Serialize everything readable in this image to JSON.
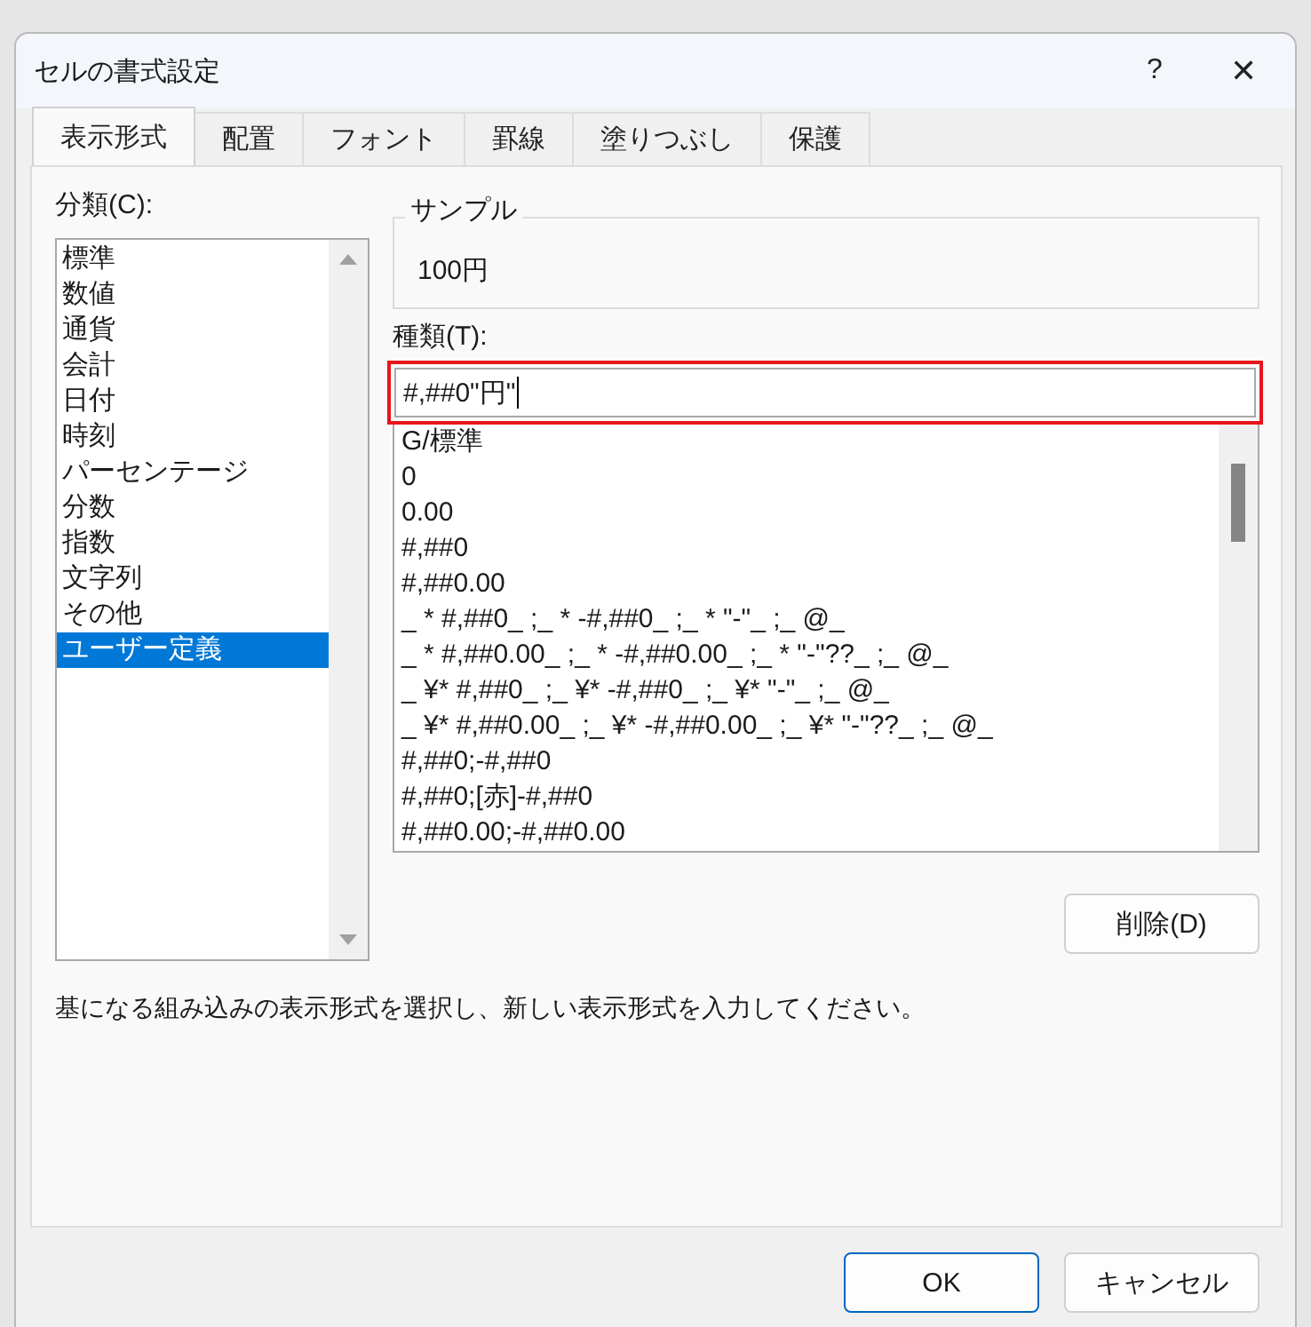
{
  "window": {
    "title": "セルの書式設定",
    "help": "?",
    "close": "✕"
  },
  "tabs": [
    {
      "label": "表示形式",
      "selected": true
    },
    {
      "label": "配置",
      "selected": false
    },
    {
      "label": "フォント",
      "selected": false
    },
    {
      "label": "罫線",
      "selected": false
    },
    {
      "label": "塗りつぶし",
      "selected": false
    },
    {
      "label": "保護",
      "selected": false
    }
  ],
  "category": {
    "label": "分類(C):",
    "items": [
      {
        "label": "標準",
        "selected": false
      },
      {
        "label": "数値",
        "selected": false
      },
      {
        "label": "通貨",
        "selected": false
      },
      {
        "label": "会計",
        "selected": false
      },
      {
        "label": "日付",
        "selected": false
      },
      {
        "label": "時刻",
        "selected": false
      },
      {
        "label": "パーセンテージ",
        "selected": false
      },
      {
        "label": "分数",
        "selected": false
      },
      {
        "label": "指数",
        "selected": false
      },
      {
        "label": "文字列",
        "selected": false
      },
      {
        "label": "その他",
        "selected": false
      },
      {
        "label": "ユーザー定義",
        "selected": true
      }
    ]
  },
  "sample": {
    "label": "サンプル",
    "value": "100円"
  },
  "type": {
    "label": "種類(T):",
    "value": "#,##0\"円\"",
    "highlighted": true,
    "formats": [
      "G/標準",
      "0",
      "0.00",
      "#,##0",
      "#,##0.00",
      "_ * #,##0_ ;_ * -#,##0_ ;_ * \"-\"_ ;_ @_",
      "_ * #,##0.00_ ;_ * -#,##0.00_ ;_ * \"-\"??_ ;_ @_",
      "_ ¥* #,##0_ ;_ ¥* -#,##0_ ;_ ¥* \"-\"_ ;_ @_",
      "_ ¥* #,##0.00_ ;_ ¥* -#,##0.00_ ;_ ¥* \"-\"??_ ;_ @_",
      "#,##0;-#,##0",
      "#,##0;[赤]-#,##0",
      "#,##0.00;-#,##0.00"
    ]
  },
  "delete_button": "削除(D)",
  "description": "基になる組み込みの表示形式を選択し、新しい表示形式を入力してください。",
  "buttons": [
    {
      "label": "OK",
      "kind": "default"
    },
    {
      "label": "キャンセル",
      "kind": "normal"
    }
  ]
}
